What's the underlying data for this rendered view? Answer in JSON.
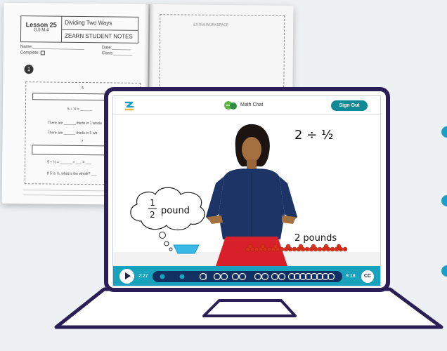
{
  "notebook": {
    "lesson_number": "Lesson 25",
    "lesson_code": "G.5 M.4",
    "lesson_title": "Dividing Two Ways",
    "notes_title": "ZEARN STUDENT NOTES",
    "name_label": "Name:",
    "date_label": "Date:",
    "complete_label": "Complete:",
    "class_label": "Class:",
    "problem_number": "1",
    "bar_label_top": "5",
    "eq1": "5 ÷ ⅓ = ______",
    "line1": "There are ______ thirds in 1 whole",
    "line2": "There are ______ thirds in 5 wh",
    "bar_label_bottom": "?",
    "eq2": "5 ÷ ⅓ = ______ × ___ = ___",
    "q": "If 5 is ⅓, what is the whole? ___",
    "extra_workspace": "EXTRA WORKSPACE"
  },
  "app": {
    "chat_label": "Math Chat",
    "sign_out": "Sign Out"
  },
  "video": {
    "equation": "2 ÷ ½",
    "cloud_fraction_num": "1",
    "cloud_fraction_den": "2",
    "cloud_text": "pound",
    "pounds_text": "2 pounds"
  },
  "player": {
    "time_current": "2:27",
    "time_total": "9:18",
    "cc_label": "CC"
  },
  "colors": {
    "accent": "#0f8a94",
    "controls": "#19a2bc",
    "laptop": "#2a1f55",
    "shirt": "#1d3466",
    "skirt": "#d8202b"
  }
}
